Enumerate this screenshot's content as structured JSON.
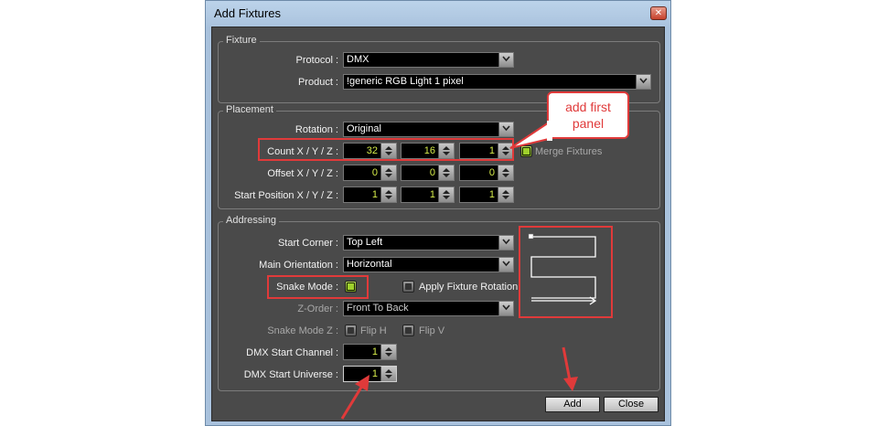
{
  "window": {
    "title": "Add Fixtures",
    "close_glyph": "✕"
  },
  "fixture": {
    "group_title": "Fixture",
    "protocol_label": "Protocol :",
    "protocol_value": "DMX",
    "product_label": "Product :",
    "product_value": "!generic RGB Light 1 pixel"
  },
  "placement": {
    "group_title": "Placement",
    "rotation_label": "Rotation :",
    "rotation_value": "Original",
    "count_label": "Count X / Y / Z :",
    "count": [
      "32",
      "16",
      "1"
    ],
    "merge_label": "Merge Fixtures",
    "offset_label": "Offset X / Y / Z :",
    "offset": [
      "0",
      "0",
      "0"
    ],
    "start_label": "Start Position X / Y / Z :",
    "start": [
      "1",
      "1",
      "1"
    ]
  },
  "addressing": {
    "group_title": "Addressing",
    "start_corner_label": "Start Corner :",
    "start_corner_value": "Top Left",
    "orientation_label": "Main Orientation :",
    "orientation_value": "Horizontal",
    "snake_label": "Snake Mode :",
    "apply_rotation_label": "Apply Fixture Rotation",
    "zorder_label": "Z-Order :",
    "zorder_value": "Front To Back",
    "snakez_label": "Snake Mode Z :",
    "fliph_label": "Flip H",
    "flipv_label": "Flip V",
    "dmx_channel_label": "DMX Start Channel :",
    "dmx_channel_value": "1",
    "dmx_universe_label": "DMX Start Universe :",
    "dmx_universe_value": "1"
  },
  "buttons": {
    "add": "Add",
    "close": "Close"
  },
  "annotation": {
    "callout_text": "add first panel",
    "color": "#e03a3a"
  },
  "colors": {
    "panel_bg": "#4a4a4a",
    "value_text": "#d6ec4a",
    "check_on": "#9fd02c"
  }
}
